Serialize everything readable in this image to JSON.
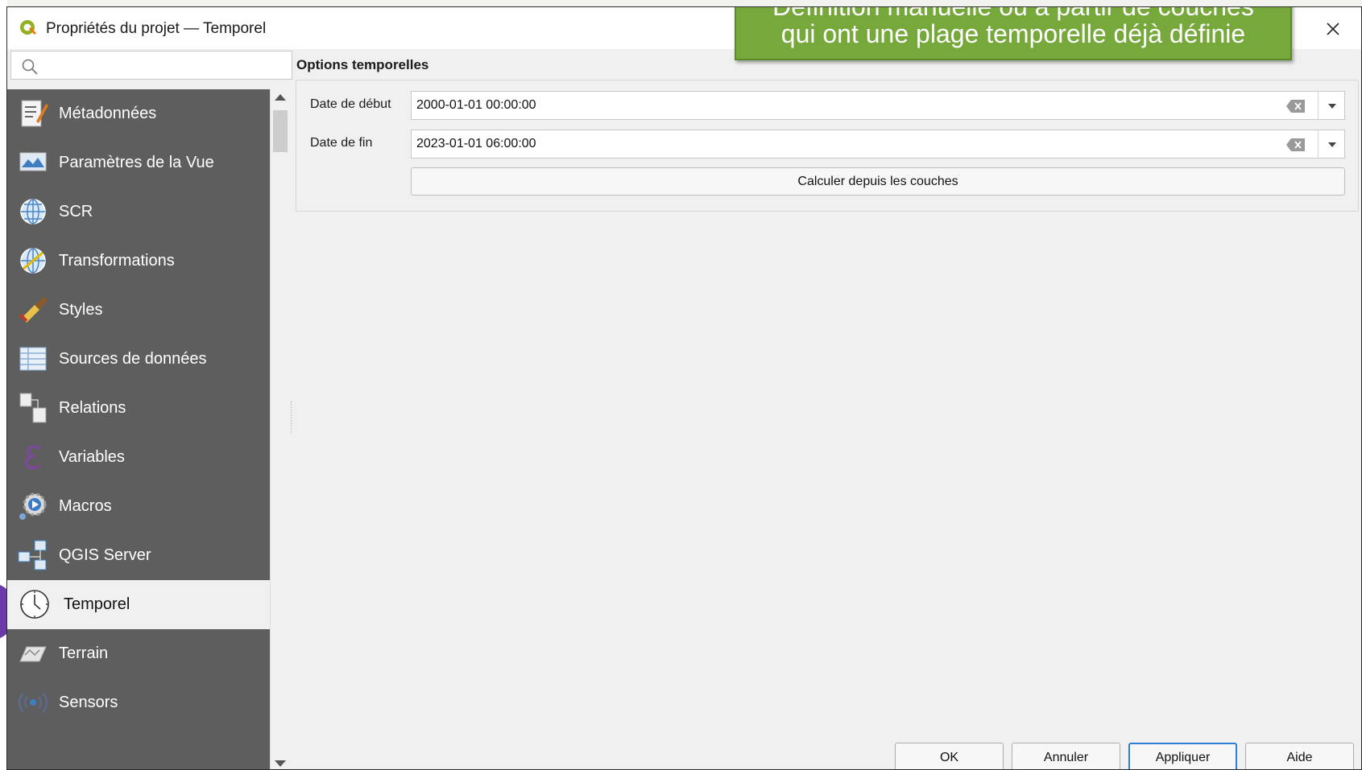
{
  "window": {
    "title": "Propriétés du projet — Temporel"
  },
  "callout": {
    "line1": "Définition manuelle ou à partir de couches",
    "line2": "qui ont une plage temporelle déjà définie"
  },
  "search": {
    "value": "",
    "placeholder": ""
  },
  "sidebar": {
    "selected": "Temporel",
    "items": [
      {
        "label": "Métadonnées",
        "icon": "metadata-icon"
      },
      {
        "label": "Paramètres de la Vue",
        "icon": "view-settings-icon"
      },
      {
        "label": "SCR",
        "icon": "globe-icon"
      },
      {
        "label": "Transformations",
        "icon": "globe-transform-icon"
      },
      {
        "label": "Styles",
        "icon": "paintbrush-icon"
      },
      {
        "label": "Sources de données",
        "icon": "table-icon"
      },
      {
        "label": "Relations",
        "icon": "relations-icon"
      },
      {
        "label": "Variables",
        "icon": "epsilon-icon"
      },
      {
        "label": "Macros",
        "icon": "macro-gear-icon"
      },
      {
        "label": "QGIS Server",
        "icon": "server-icon"
      },
      {
        "label": "Temporel",
        "icon": "clock-icon"
      },
      {
        "label": "Terrain",
        "icon": "terrain-icon"
      },
      {
        "label": "Sensors",
        "icon": "sensor-icon"
      }
    ]
  },
  "content": {
    "section_title": "Options temporelles",
    "start_label": "Date de début",
    "start_value": "2000-01-01 00:00:00",
    "end_label": "Date de fin",
    "end_value": "2023-01-01 06:00:00",
    "calc_button": "Calculer depuis les couches"
  },
  "buttons": {
    "ok": "OK",
    "cancel": "Annuler",
    "apply": "Appliquer",
    "help": "Aide"
  },
  "colors": {
    "sidebar_bg": "#5e5e5e",
    "callout_bg": "#77a83c",
    "accent": "#2f7fd6"
  }
}
